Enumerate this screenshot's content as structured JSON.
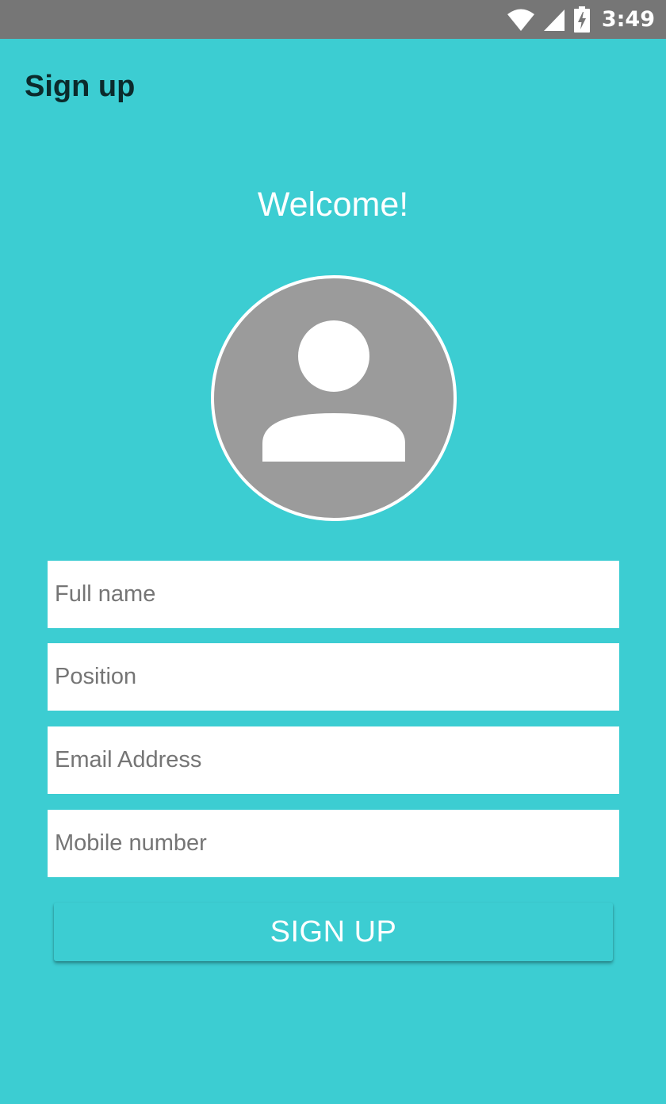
{
  "status_bar": {
    "time": "3:49",
    "icons": [
      "wifi-icon",
      "cell-signal-icon",
      "battery-charging-icon"
    ]
  },
  "app_bar": {
    "title": "Sign up"
  },
  "welcome": {
    "text": "Welcome!"
  },
  "avatar": {
    "icon": "person-placeholder-icon"
  },
  "form": {
    "full_name": {
      "placeholder": "Full name",
      "value": ""
    },
    "position": {
      "placeholder": "Position",
      "value": ""
    },
    "email": {
      "placeholder": "Email Address",
      "value": ""
    },
    "mobile": {
      "placeholder": "Mobile number",
      "value": ""
    }
  },
  "actions": {
    "signup_label": "SIGN UP"
  },
  "colors": {
    "background": "#3ccdd2",
    "status_bar": "#767676",
    "avatar": "#9b9b9b",
    "title_text": "#0b2a2c"
  }
}
